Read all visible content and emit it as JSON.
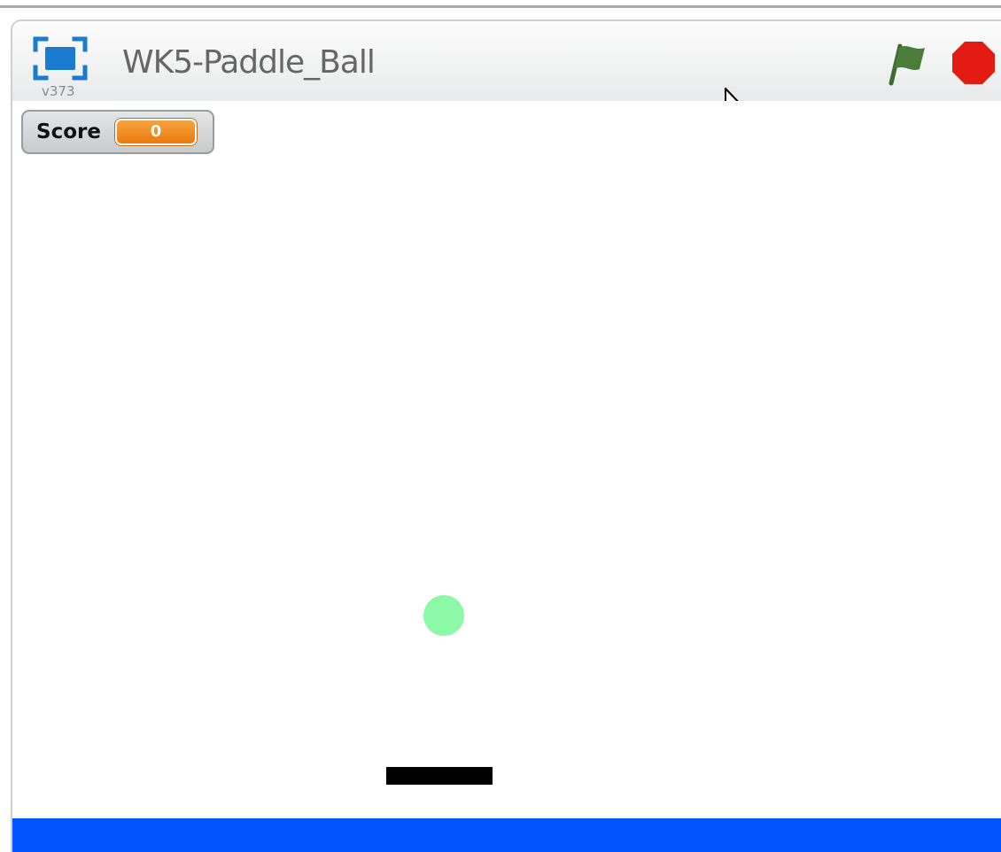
{
  "player": {
    "title": "WK5-Paddle_Ball",
    "version": "v373"
  },
  "controls": {
    "fullscreen_icon": "fullscreen-icon",
    "green_flag_icon": "green-flag-icon",
    "stop_icon": "stop-sign-icon",
    "flag_color": "#4a7d3a",
    "stop_color": "#e31b13"
  },
  "stage": {
    "monitor": {
      "label": "Score",
      "value": "0",
      "value_color": "#ef8c1f"
    },
    "ball_color": "#8cf9a8",
    "paddle_color": "#000000",
    "floor_color": "#0055ff"
  }
}
